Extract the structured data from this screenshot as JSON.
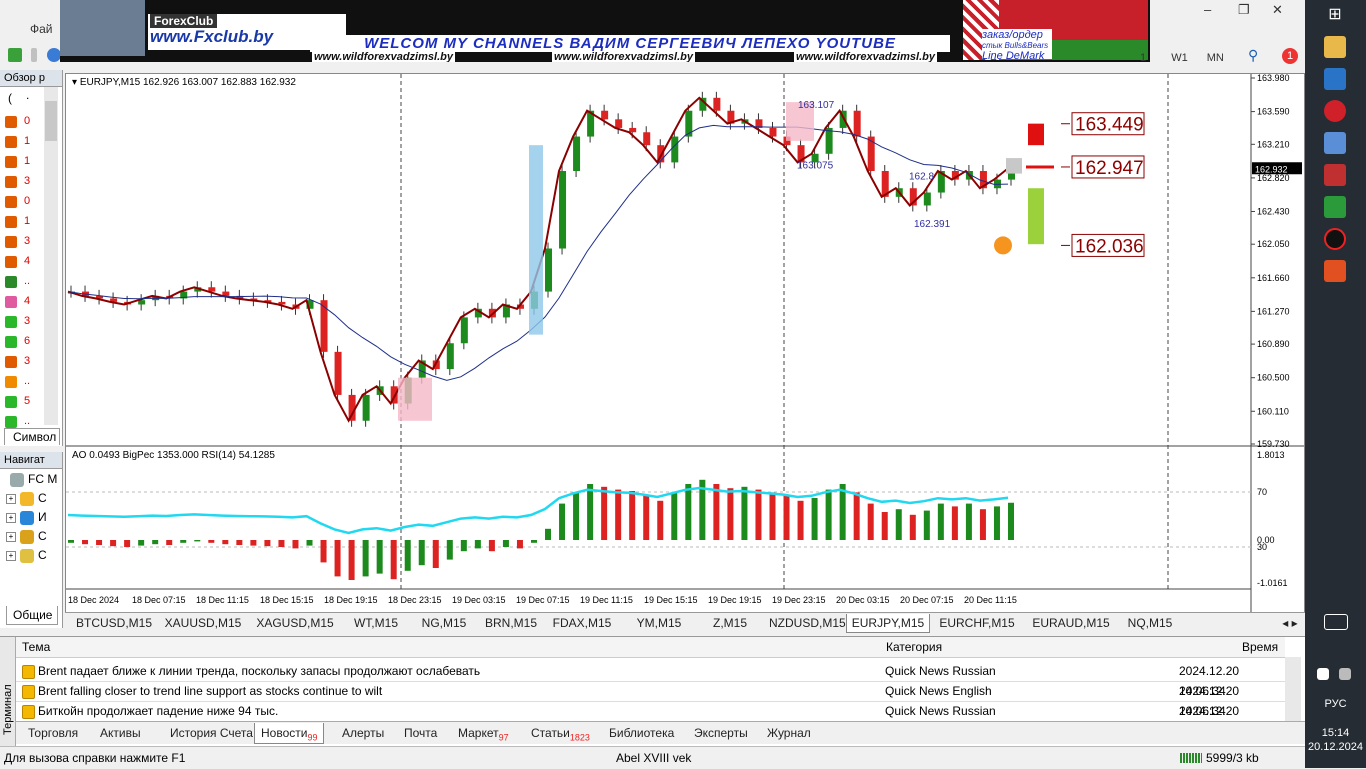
{
  "menu": {
    "file_label": "Фай"
  },
  "banner": {
    "brand_top": "ForexClub",
    "brand_site": "www.Fxclub.by",
    "welcome": "WELCOM MY CHANNELS ВАДИМ СЕРГЕЕВИЧ ЛЕПЕХО YOUTUBE",
    "url1": "www.wildforexvadzimsl.by",
    "url2": "www.wildforexvadzimsl.by",
    "url3": "www.wildforexvadzimsl.by",
    "order_line1": "заказ/ордер",
    "order_line2": "стык Bulls&Bears",
    "order_line3": "Line DeMark"
  },
  "timeframes": {
    "h1": "1",
    "w1": "W1",
    "mn": "MN"
  },
  "notifications": {
    "count": "1"
  },
  "market_watch": {
    "title": "Обзор р",
    "header_glyph": "(",
    "rows": [
      {
        "value": "0",
        "color": "#e05a00"
      },
      {
        "value": "1",
        "color": "#e05a00"
      },
      {
        "value": "1",
        "color": "#e05a00"
      },
      {
        "value": "3",
        "color": "#e05a00"
      },
      {
        "value": "0",
        "color": "#e05a00"
      },
      {
        "value": "1",
        "color": "#e05a00"
      },
      {
        "value": "3",
        "color": "#e05a00"
      },
      {
        "value": "4",
        "color": "#e05a00"
      },
      {
        "value": "..",
        "color": "#2a8a2a"
      },
      {
        "value": "4",
        "color": "#e05aa0"
      },
      {
        "value": "3",
        "color": "#2ab82a"
      },
      {
        "value": "6",
        "color": "#2ab82a"
      },
      {
        "value": "3",
        "color": "#e05a00"
      },
      {
        "value": "..",
        "color": "#f08a00"
      },
      {
        "value": "5",
        "color": "#2ab82a"
      },
      {
        "value": "..",
        "color": "#2ab82a"
      }
    ],
    "symbols_tab": "Символ"
  },
  "navigator": {
    "title": "Навигат",
    "root": "FC M",
    "items": [
      {
        "label": "С",
        "icon": "accounts-icon"
      },
      {
        "label": "И",
        "icon": "indicators-icon"
      },
      {
        "label": "С",
        "icon": "experts-icon"
      },
      {
        "label": "С",
        "icon": "scripts-icon"
      }
    ],
    "tab": "Общие"
  },
  "chart": {
    "header": "EURJPY,M15  162.926 163.007 162.883 162.932",
    "sub_header": "AO 0.0493  BigPec 1353.000  RSI(14) 54.1285",
    "level_high": "163.449",
    "level_mid": "162.947",
    "level_low": "162.036",
    "label_peak": "163.107",
    "label_a": "163.075",
    "label_b": "162.391",
    "label_c": "162.8",
    "current_price": "162.932"
  },
  "chart_data": {
    "type": "line",
    "symbol": "EURJPY",
    "timeframe": "M15",
    "y_ticks": [
      "163.980",
      "163.590",
      "163.210",
      "162.820",
      "162.430",
      "162.050",
      "161.660",
      "161.270",
      "160.890",
      "160.500",
      "160.110",
      "159.730"
    ],
    "ylim": [
      159.73,
      163.98
    ],
    "x_ticks": [
      "18 Dec 2024",
      "18 Dec 07:15",
      "18 Dec 11:15",
      "18 Dec 15:15",
      "18 Dec 19:15",
      "18 Dec 23:15",
      "19 Dec 03:15",
      "19 Dec 07:15",
      "19 Dec 11:15",
      "19 Dec 15:15",
      "19 Dec 19:15",
      "19 Dec 23:15",
      "20 Dec 03:15",
      "20 Dec 07:15",
      "20 Dec 11:15"
    ],
    "series": [
      {
        "values": [
          161.5,
          161.45,
          161.42,
          161.38,
          161.35,
          161.4,
          161.45,
          161.42,
          161.5,
          161.55,
          161.5,
          161.45,
          161.42,
          161.4,
          161.38,
          161.35,
          161.3,
          161.4,
          160.8,
          160.3,
          160.0,
          160.3,
          160.4,
          160.2,
          160.5,
          160.7,
          160.6,
          160.9,
          161.2,
          161.3,
          161.2,
          161.35,
          161.3,
          161.5,
          162.0,
          162.9,
          163.3,
          163.6,
          163.5,
          163.4,
          163.35,
          163.2,
          163.0,
          163.3,
          163.6,
          163.75,
          163.6,
          163.45,
          163.5,
          163.4,
          163.3,
          163.2,
          163.0,
          163.1,
          163.4,
          163.6,
          163.3,
          162.9,
          162.6,
          162.7,
          162.5,
          162.65,
          162.9,
          162.8,
          162.9,
          162.7,
          162.8,
          162.93
        ]
      }
    ],
    "oscillator": {
      "y_ticks": [
        "1.8013",
        "70",
        "0.00",
        "30",
        "-1.0161"
      ],
      "ylim": [
        -1.0161,
        1.8013
      ]
    }
  },
  "symbol_tabs": [
    "BTCUSD,M15",
    "XAUUSD,M15",
    "XAGUSD,M15",
    "WT,M15",
    "NG,M15",
    "BRN,M15",
    "FDAX,M15",
    "YM,M15",
    "Z,M15",
    "NZDUSD,M15",
    "EURJPY,M15",
    "EURCHF,M15",
    "EURAUD,M15",
    "NQ,M15"
  ],
  "active_symbol_tab": "EURJPY,M15",
  "terminal": {
    "side_label": "Терминал",
    "columns": {
      "topic": "Тема",
      "category": "Категория",
      "time": "Время"
    },
    "rows": [
      {
        "topic": "Brent падает ближе к линии тренда, поскольку запасы продолжают ослабевать",
        "category": "Quick News Russian",
        "time": "2024.12.20 14:06:34"
      },
      {
        "topic": "Brent falling closer to trend line support as stocks continue to wilt",
        "category": "Quick News English",
        "time": "2024.12.20 14:06:34"
      },
      {
        "topic": "Биткойн продолжает падение ниже 94 тыс.",
        "category": "Quick News Russian",
        "time": "2024.12.20 13:27:35"
      }
    ],
    "tabs": [
      {
        "label": "Торговля",
        "badge": ""
      },
      {
        "label": "Активы",
        "badge": ""
      },
      {
        "label": "История Счета",
        "badge": ""
      },
      {
        "label": "Новости",
        "badge": "99"
      },
      {
        "label": "Алерты",
        "badge": ""
      },
      {
        "label": "Почта",
        "badge": ""
      },
      {
        "label": "Маркет",
        "badge": "97"
      },
      {
        "label": "Статьи",
        "badge": "1823"
      },
      {
        "label": "Библиотека",
        "badge": ""
      },
      {
        "label": "Эксперты",
        "badge": ""
      },
      {
        "label": "Журнал",
        "badge": ""
      }
    ]
  },
  "status": {
    "help": "Для вызова справки нажмите F1",
    "profile": "Abel XVIII vek",
    "traffic": "5999/3 kb"
  },
  "taskbar": {
    "language": "РУС",
    "time": "15:14",
    "date": "20.12.2024"
  }
}
